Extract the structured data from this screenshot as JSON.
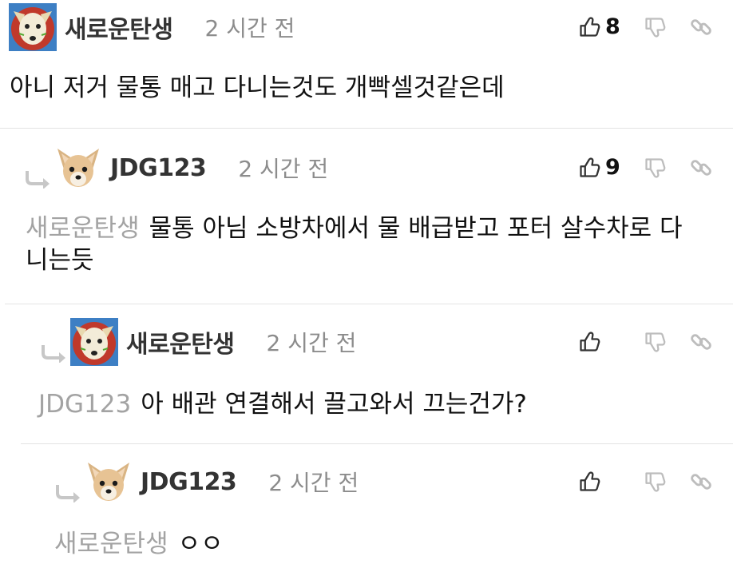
{
  "comments": [
    {
      "author": "새로운탄생",
      "time": "2 시간 전",
      "likes": "8",
      "mention": "",
      "text": "아니 저거 물통 매고 다니는것도 개빡셀것같은데",
      "avatar": "tiger-avatar"
    },
    {
      "author": "JDG123",
      "time": "2 시간 전",
      "likes": "9",
      "mention": "새로운탄생",
      "text": "물통 아님 소방차에서 물 배급받고 포터 살수차로 다니는듯",
      "avatar": "dog-avatar"
    },
    {
      "author": "새로운탄생",
      "time": "2 시간 전",
      "likes": "",
      "mention": "JDG123",
      "text": "아 배관 연결해서 끌고와서 끄는건가?",
      "avatar": "tiger-avatar"
    },
    {
      "author": "JDG123",
      "time": "2 시간 전",
      "likes": "",
      "mention": "새로운탄생",
      "text": "ㅇㅇ",
      "avatar": "dog-avatar"
    }
  ],
  "icons": {
    "like": "thumbs-up-icon",
    "dislike": "thumbs-down-icon",
    "link": "link-icon",
    "reply": "reply-arrow-icon"
  },
  "colors": {
    "author": "#333333",
    "time": "#8c8c8c",
    "mention": "#a3a3a3",
    "separator": "#e3e3e3"
  }
}
